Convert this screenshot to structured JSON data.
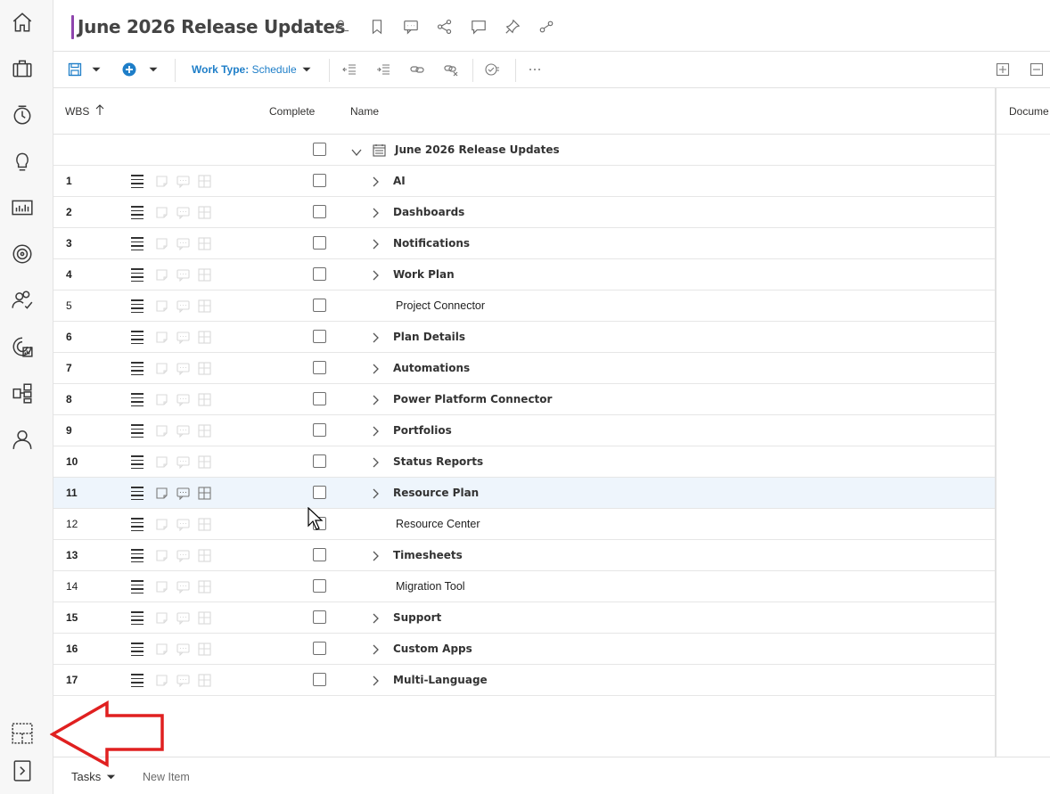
{
  "header": {
    "title": "June 2026 Release Updates",
    "accent": "#8e44ad",
    "icons": [
      "person-icon",
      "bookmark-icon",
      "comment-icon",
      "share-icon",
      "chat-icon",
      "pin-icon",
      "link-icon"
    ]
  },
  "toolbar": {
    "work_type_label": "Work Type:",
    "work_type_value": "Schedule",
    "accent": "#1e7ec8"
  },
  "columns": {
    "wbs": "WBS",
    "complete": "Complete",
    "name": "Name",
    "document": "Docume"
  },
  "root_row": {
    "name": "June 2026 Release Updates"
  },
  "rows": [
    {
      "wbs": "1",
      "name": "AI",
      "bold": true,
      "expandable": true
    },
    {
      "wbs": "2",
      "name": "Dashboards",
      "bold": true,
      "expandable": true
    },
    {
      "wbs": "3",
      "name": "Notifications",
      "bold": true,
      "expandable": true
    },
    {
      "wbs": "4",
      "name": "Work Plan",
      "bold": true,
      "expandable": true
    },
    {
      "wbs": "5",
      "name": "Project Connector",
      "bold": false,
      "expandable": false
    },
    {
      "wbs": "6",
      "name": "Plan Details",
      "bold": true,
      "expandable": true
    },
    {
      "wbs": "7",
      "name": "Automations",
      "bold": true,
      "expandable": true
    },
    {
      "wbs": "8",
      "name": "Power Platform Connector",
      "bold": true,
      "expandable": true
    },
    {
      "wbs": "9",
      "name": "Portfolios",
      "bold": true,
      "expandable": true
    },
    {
      "wbs": "10",
      "name": "Status Reports",
      "bold": true,
      "expandable": true
    },
    {
      "wbs": "11",
      "name": "Resource Plan",
      "bold": true,
      "expandable": true,
      "selected": true
    },
    {
      "wbs": "12",
      "name": "Resource Center",
      "bold": false,
      "expandable": false
    },
    {
      "wbs": "13",
      "name": "Timesheets",
      "bold": true,
      "expandable": true
    },
    {
      "wbs": "14",
      "name": "Migration Tool",
      "bold": false,
      "expandable": false
    },
    {
      "wbs": "15",
      "name": "Support",
      "bold": true,
      "expandable": true
    },
    {
      "wbs": "16",
      "name": "Custom Apps",
      "bold": true,
      "expandable": true
    },
    {
      "wbs": "17",
      "name": "Multi-Language",
      "bold": true,
      "expandable": true
    }
  ],
  "bottom": {
    "tab": "Tasks",
    "new_item": "New Item"
  },
  "annotation": {
    "arrow_color": "#e02020"
  }
}
